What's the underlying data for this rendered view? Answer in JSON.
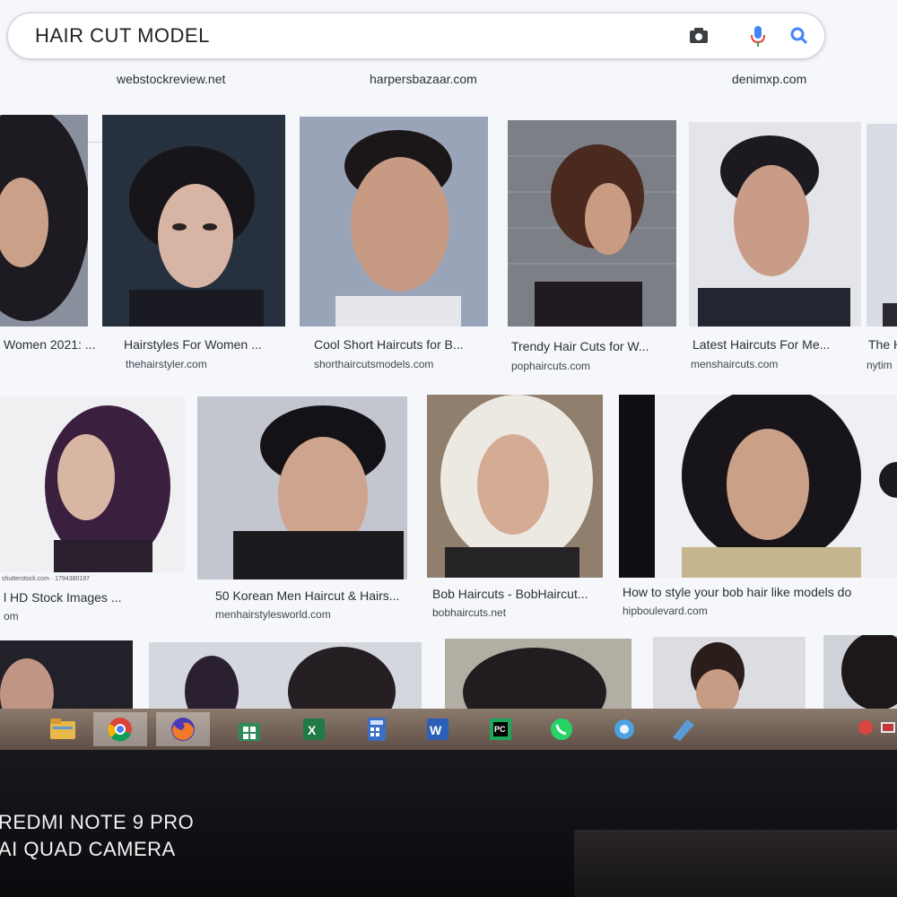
{
  "search": {
    "query": "HAIR CUT MODEL",
    "camera_icon": "camera-icon",
    "mic_icon": "microphone-icon",
    "search_icon": "search-icon"
  },
  "top_sources": [
    "webstockreview.net",
    "harpersbazaar.com",
    "denimxp.com"
  ],
  "results": {
    "row1": [
      {
        "title": "Women 2021: ...",
        "source": ""
      },
      {
        "title": "Hairstyles For Women ...",
        "source": "thehairstyler.com"
      },
      {
        "title": "Cool Short Haircuts for B...",
        "source": "shorthaircutsmodels.com"
      },
      {
        "title": "Trendy Hair Cuts for W...",
        "source": "pophaircuts.com"
      },
      {
        "title": "Latest Haircuts For Me...",
        "source": "menshaircuts.com"
      },
      {
        "title": "The H",
        "source": "nytim"
      }
    ],
    "row2": [
      {
        "title": "l HD Stock Images ...",
        "source": "om",
        "watermark": "shutterstock.com · 1794380197"
      },
      {
        "title": "50 Korean Men Haircut & Hairs...",
        "source": "menhairstylesworld.com"
      },
      {
        "title": "Bob Haircuts - BobHaircut...",
        "source": "bobhaircuts.net"
      },
      {
        "title": "How to style your bob hair like models do",
        "source": "hipboulevard.com"
      }
    ]
  },
  "taskbar": {
    "apps": [
      {
        "name": "file-explorer-icon",
        "color": "#e8b84a"
      },
      {
        "name": "chrome-icon",
        "color": "#3ba55c"
      },
      {
        "name": "firefox-icon",
        "color": "#f07a2a"
      },
      {
        "name": "store-icon",
        "color": "#2e8b57"
      },
      {
        "name": "excel-icon",
        "color": "#1f7a45"
      },
      {
        "name": "calculator-icon",
        "color": "#3a6fc4"
      },
      {
        "name": "word-icon",
        "color": "#2b5fb8"
      },
      {
        "name": "pycharm-icon",
        "color": "#1aa85a"
      },
      {
        "name": "whatsapp-icon",
        "color": "#25d366"
      },
      {
        "name": "settings-icon",
        "color": "#4aa3df"
      },
      {
        "name": "app-icon",
        "color": "#5b9bd5"
      }
    ]
  },
  "photo_overlay": {
    "line1": "REDMI NOTE 9 PRO",
    "line2": "AI QUAD CAMERA"
  }
}
